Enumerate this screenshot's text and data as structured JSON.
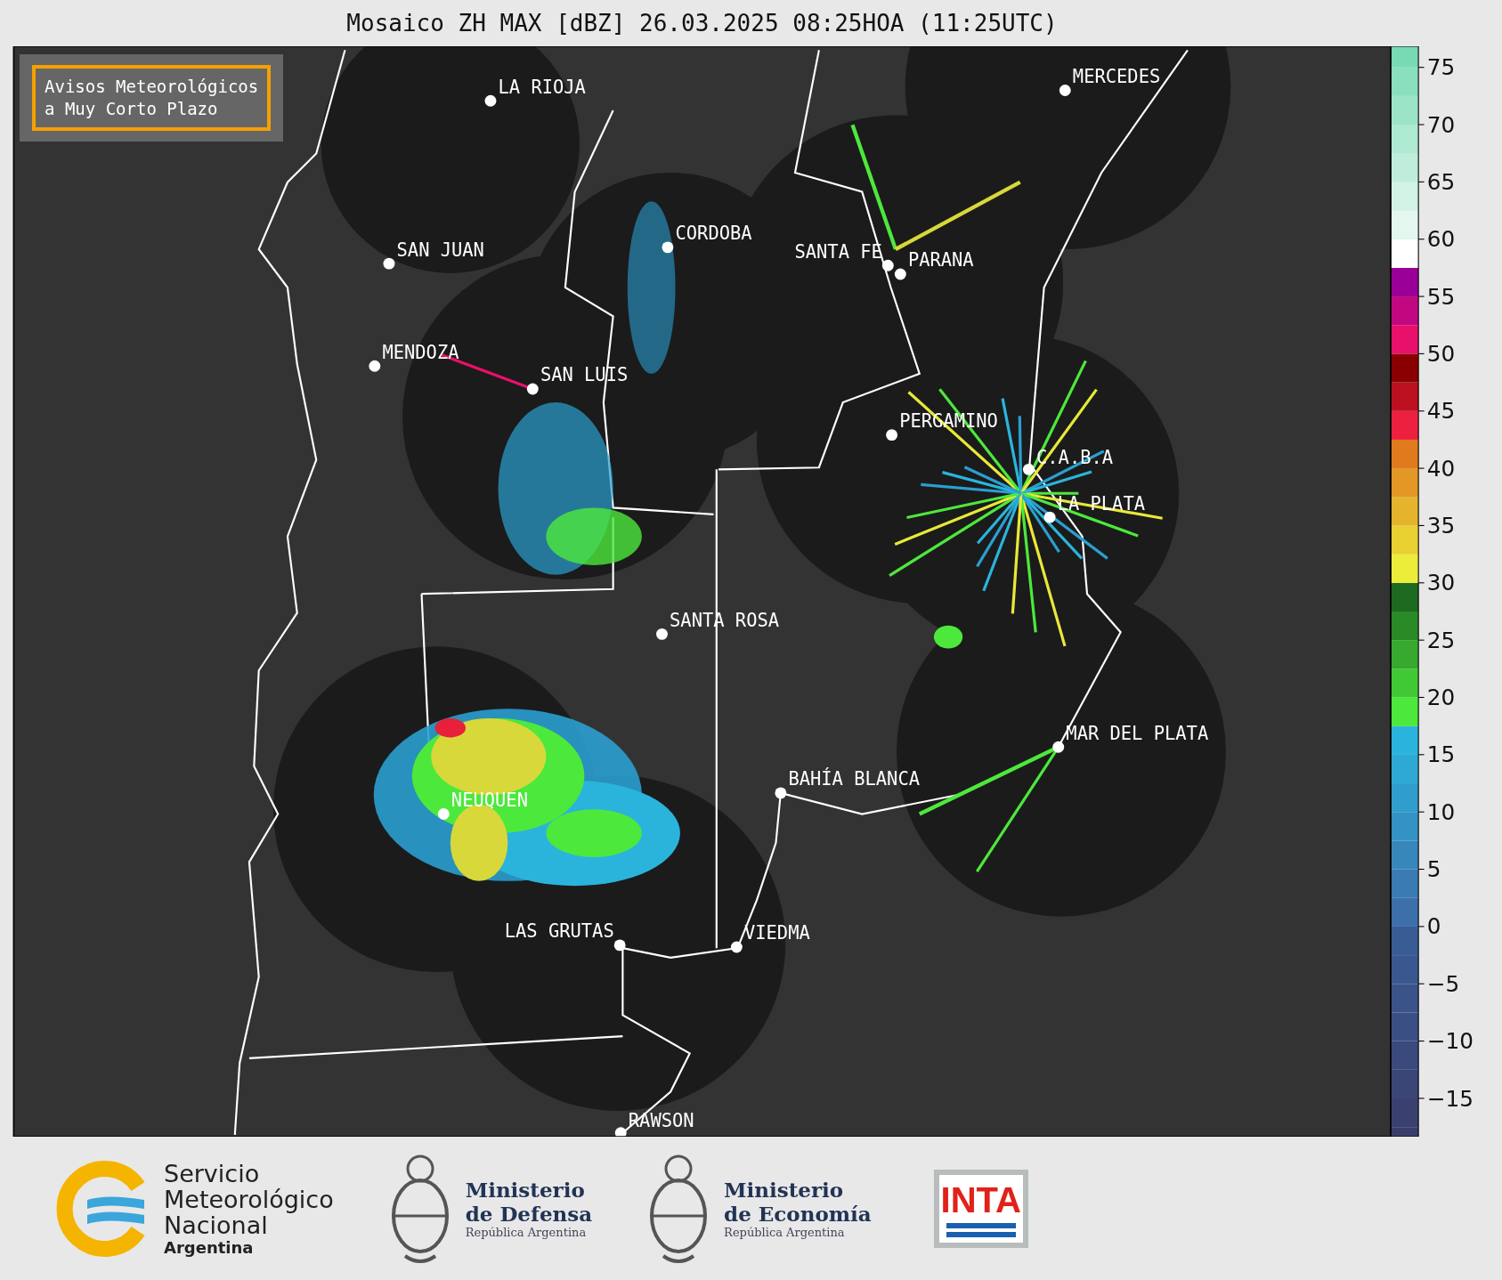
{
  "title": "Mosaico ZH MAX [dBZ] 26.03.2025 08:25HOA (11:25UTC)",
  "notice": {
    "lines": [
      "Avisos Meteorológicos",
      "a Muy Corto Plazo"
    ]
  },
  "cities": [
    {
      "name": "LA RIOJA"
    },
    {
      "name": "MERCEDES"
    },
    {
      "name": "SAN JUAN"
    },
    {
      "name": "CORDOBA"
    },
    {
      "name": "SANTA FE"
    },
    {
      "name": "PARANA"
    },
    {
      "name": "MENDOZA"
    },
    {
      "name": "SAN LUIS"
    },
    {
      "name": "PERGAMINO"
    },
    {
      "name": "C.A.B.A"
    },
    {
      "name": "LA PLATA"
    },
    {
      "name": "SANTA ROSA"
    },
    {
      "name": "MAR DEL PLATA"
    },
    {
      "name": "BAHÍA BLANCA"
    },
    {
      "name": "NEUQUEN"
    },
    {
      "name": "LAS GRUTAS"
    },
    {
      "name": "VIEDMA"
    },
    {
      "name": "RAWSON"
    }
  ],
  "colorbar": {
    "ticks": [
      "75",
      "70",
      "65",
      "60",
      "55",
      "50",
      "45",
      "40",
      "35",
      "30",
      "25",
      "20",
      "15",
      "10",
      "5",
      "0",
      "−5",
      "−10",
      "−15"
    ]
  },
  "logos": [
    {
      "kind": "smn",
      "lines": [
        "Servicio",
        "Meteorológico",
        "Nacional"
      ],
      "subtitle": "Argentina"
    },
    {
      "kind": "ministry",
      "lines": [
        "Ministerio",
        "de Defensa"
      ],
      "subtitle": "República Argentina"
    },
    {
      "kind": "ministry",
      "lines": [
        "Ministerio",
        "de Economía"
      ],
      "subtitle": "República Argentina"
    },
    {
      "kind": "inta",
      "text": "INTA"
    }
  ]
}
